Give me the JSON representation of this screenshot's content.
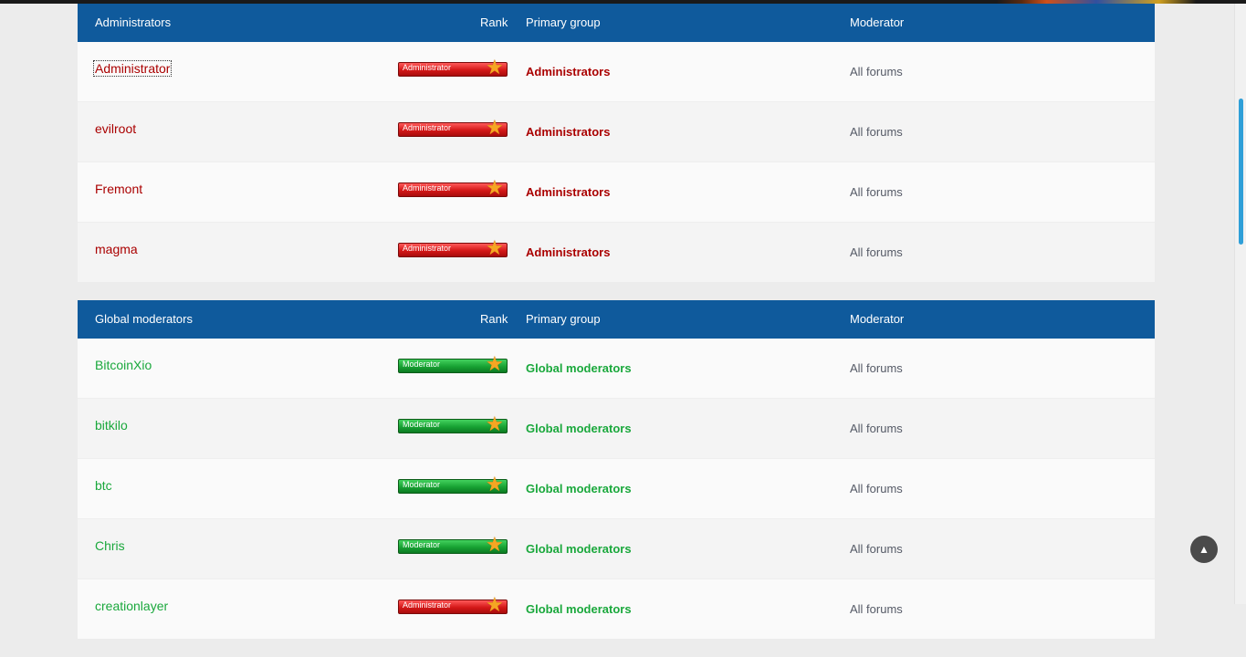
{
  "admins": {
    "header": {
      "name_col": "Administrators",
      "rank_col": "Rank",
      "group_col": "Primary group",
      "mod_col": "Moderator"
    },
    "rows": [
      {
        "username": "Administrator",
        "rank": "Administrator",
        "group": "Administrators",
        "moderator": "All forums"
      },
      {
        "username": "evilroot",
        "rank": "Administrator",
        "group": "Administrators",
        "moderator": "All forums"
      },
      {
        "username": "Fremont",
        "rank": "Administrator",
        "group": "Administrators",
        "moderator": "All forums"
      },
      {
        "username": "magma",
        "rank": "Administrator",
        "group": "Administrators",
        "moderator": "All forums"
      }
    ]
  },
  "gmods": {
    "header": {
      "name_col": "Global moderators",
      "rank_col": "Rank",
      "group_col": "Primary group",
      "mod_col": "Moderator"
    },
    "rows": [
      {
        "username": "BitcoinXio",
        "rank": "Moderator",
        "group": "Global moderators",
        "moderator": "All forums"
      },
      {
        "username": "bitkilo",
        "rank": "Moderator",
        "group": "Global moderators",
        "moderator": "All forums"
      },
      {
        "username": "btc",
        "rank": "Moderator",
        "group": "Global moderators",
        "moderator": "All forums"
      },
      {
        "username": "Chris",
        "rank": "Moderator",
        "group": "Global moderators",
        "moderator": "All forums"
      },
      {
        "username": "creationlayer",
        "rank": "Administrator",
        "group": "Global moderators",
        "moderator": "All forums"
      }
    ]
  },
  "colors": {
    "header_bg": "#0f5a9c",
    "admin_color": "#aa0000",
    "gmod_color": "#1aa83c"
  },
  "icons": {
    "rank_star": "star-icon",
    "back_to_top": "chevron-up-icon"
  },
  "back_to_top_glyph": "▲"
}
